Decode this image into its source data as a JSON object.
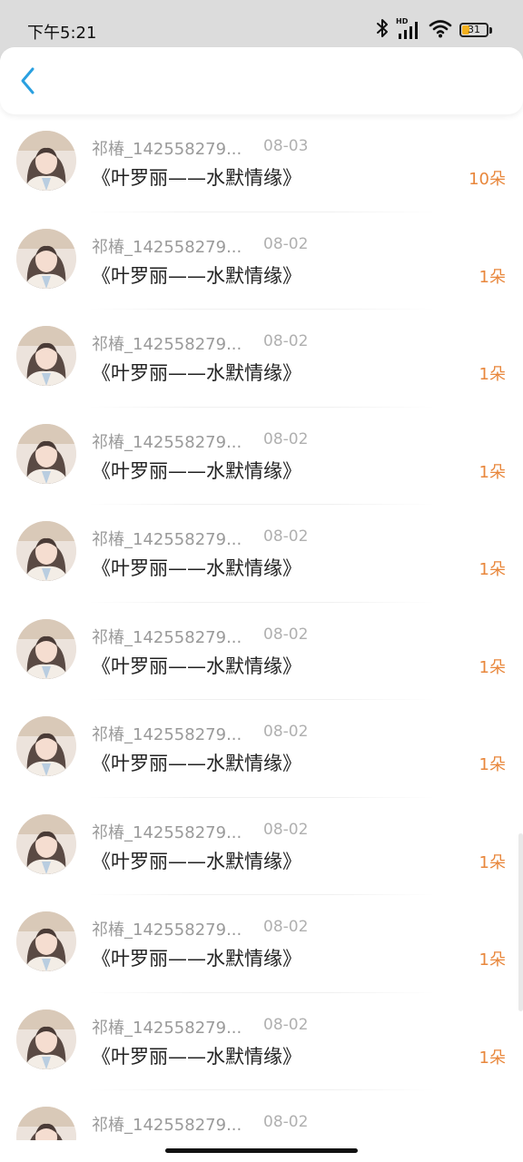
{
  "status_bar": {
    "time": "下午5:21",
    "battery_level": "31",
    "battery_color": "#f2b01e",
    "icons": [
      "bluetooth-icon",
      "hd-signal-icon",
      "wifi-icon",
      "battery-icon"
    ],
    "hd_label": "HD"
  },
  "header": {
    "back_icon": "chevron-left-icon",
    "accent_color": "#2aa0e0"
  },
  "list": {
    "items": [
      {
        "username": "祁椿_142558279...",
        "date": "08-03",
        "title": "《叶罗丽——水默情缘》",
        "count": "10朵"
      },
      {
        "username": "祁椿_142558279...",
        "date": "08-02",
        "title": "《叶罗丽——水默情缘》",
        "count": "1朵"
      },
      {
        "username": "祁椿_142558279...",
        "date": "08-02",
        "title": "《叶罗丽——水默情缘》",
        "count": "1朵"
      },
      {
        "username": "祁椿_142558279...",
        "date": "08-02",
        "title": "《叶罗丽——水默情缘》",
        "count": "1朵"
      },
      {
        "username": "祁椿_142558279...",
        "date": "08-02",
        "title": "《叶罗丽——水默情缘》",
        "count": "1朵"
      },
      {
        "username": "祁椿_142558279...",
        "date": "08-02",
        "title": "《叶罗丽——水默情缘》",
        "count": "1朵"
      },
      {
        "username": "祁椿_142558279...",
        "date": "08-02",
        "title": "《叶罗丽——水默情缘》",
        "count": "1朵"
      },
      {
        "username": "祁椿_142558279...",
        "date": "08-02",
        "title": "《叶罗丽——水默情缘》",
        "count": "1朵"
      },
      {
        "username": "祁椿_142558279...",
        "date": "08-02",
        "title": "《叶罗丽——水默情缘》",
        "count": "1朵"
      },
      {
        "username": "祁椿_142558279...",
        "date": "08-02",
        "title": "《叶罗丽——水默情缘》",
        "count": "1朵"
      },
      {
        "username": "祁椿_142558279...",
        "date": "08-02",
        "title": "",
        "count": ""
      }
    ],
    "count_color": "#e8873c"
  }
}
